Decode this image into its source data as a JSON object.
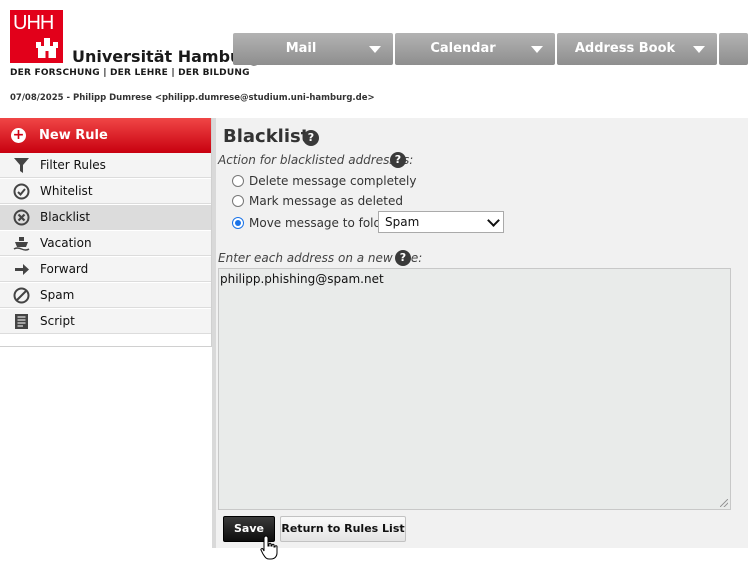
{
  "brand": {
    "logo_text": "UHH",
    "name": "Universität Hamburg",
    "tagline": "DER FORSCHUNG | DER LEHRE | DER BILDUNG",
    "color": "#e2001a"
  },
  "user_line": "07/08/2025 - Philipp Dumrese <philipp.dumrese@studium.uni-hamburg.de>",
  "topnav": [
    {
      "label": "Mail"
    },
    {
      "label": "Calendar"
    },
    {
      "label": "Address Book"
    }
  ],
  "sidebar": {
    "new_rule": "New Rule",
    "items": [
      {
        "label": "Filter Rules",
        "icon": "funnel-icon"
      },
      {
        "label": "Whitelist",
        "icon": "check-circle-icon"
      },
      {
        "label": "Blacklist",
        "icon": "x-circle-icon",
        "active": true
      },
      {
        "label": "Vacation",
        "icon": "ship-icon"
      },
      {
        "label": "Forward",
        "icon": "arrow-right-icon"
      },
      {
        "label": "Spam",
        "icon": "no-entry-icon"
      },
      {
        "label": "Script",
        "icon": "script-icon"
      }
    ]
  },
  "main": {
    "title": "Blacklist",
    "action_label": "Action for blacklisted addresses:",
    "options": [
      {
        "label": "Delete message completely",
        "checked": false
      },
      {
        "label": "Mark message as deleted",
        "checked": false
      },
      {
        "label": "Move message to folder:",
        "checked": true
      }
    ],
    "folder_value": "Spam",
    "address_label": "Enter each address on a new line:",
    "addresses": "philipp.phishing@spam.net",
    "save_label": "Save",
    "return_label": "Return to Rules List"
  },
  "colors": {
    "accent": "#e2001a",
    "radio": "#1a73e8"
  }
}
